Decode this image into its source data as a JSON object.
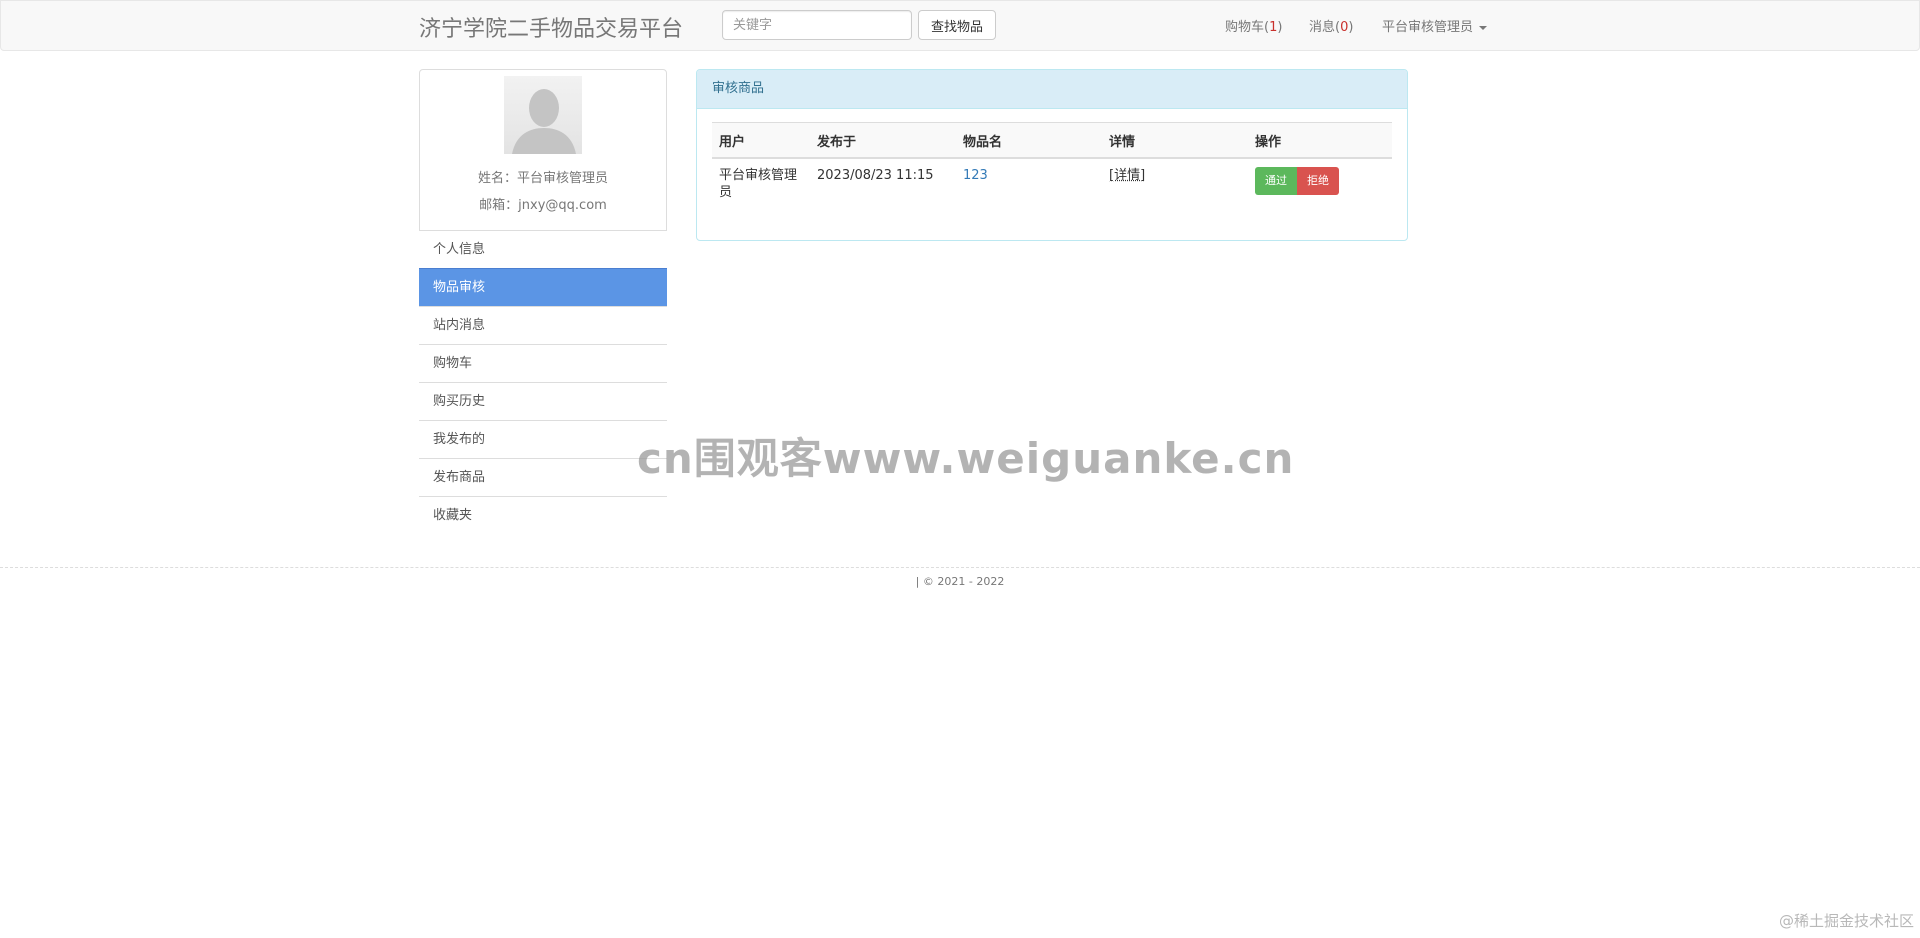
{
  "navbar": {
    "brand": "济宁学院二手物品交易平台",
    "search_placeholder": "关键字",
    "search_button": "查找物品",
    "cart_label": "购物车(",
    "cart_count": "1",
    "messages_label": "消息(",
    "messages_count": "0",
    "close_paren": ")",
    "user_menu": "平台审核管理员"
  },
  "profile": {
    "name_line": "姓名：平台审核管理员",
    "email_line": "邮箱：jnxy@qq.com"
  },
  "sidebar": {
    "items": [
      {
        "label": "个人信息"
      },
      {
        "label": "物品审核"
      },
      {
        "label": "站内消息"
      },
      {
        "label": "购物车"
      },
      {
        "label": "购买历史"
      },
      {
        "label": "我发布的"
      },
      {
        "label": "发布商品"
      },
      {
        "label": "收藏夹"
      }
    ]
  },
  "panel": {
    "title": "审核商品",
    "columns": [
      "用户",
      "发布于",
      "物品名",
      "详情",
      "操作"
    ],
    "rows": [
      {
        "user": "平台审核管理员",
        "date": "2023/08/23 11:15",
        "item": "123",
        "detail": "[详情]",
        "approve": "通过",
        "reject": "拒绝"
      }
    ]
  },
  "watermark": "cn围观客www.weiguanke.cn",
  "footer": {
    "copyright": "| © 2021 - 2022"
  },
  "community_mark": "@稀土掘金技术社区",
  "colors": {
    "active_menu": "#5b95e5",
    "panel_heading": "#d9edf7",
    "approve": "#5cb85c",
    "reject": "#d9534f",
    "badge_count": "#c9302c"
  }
}
